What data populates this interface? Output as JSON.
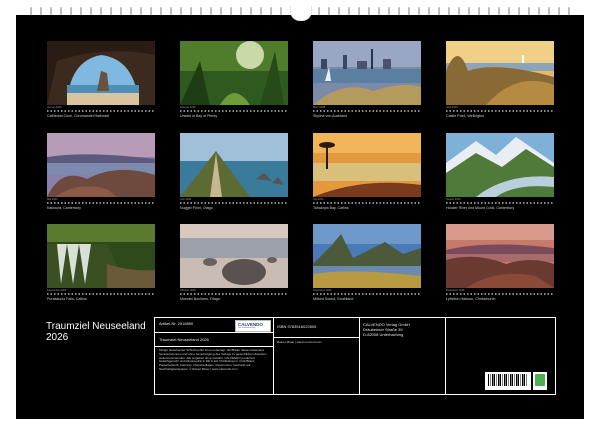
{
  "calendar": {
    "title_line1": "Traumziel Neuseeland",
    "title_line2": "2026",
    "months": [
      {
        "month": "Januar 2026",
        "caption": "Cathedral Cove, Coromandel Halbinsel"
      },
      {
        "month": "Februar 2026",
        "caption": "Urwald in Bay of Plenty"
      },
      {
        "month": "März 2026",
        "caption": "Skyline von Auckland"
      },
      {
        "month": "April 2026",
        "caption": "Castle Point, Wellington"
      },
      {
        "month": "Mai 2026",
        "caption": "Kaikoura, Canterbury"
      },
      {
        "month": "Juni 2026",
        "caption": "Nugget Point, Otago"
      },
      {
        "month": "Juli 2026",
        "caption": "Tahakopa Bay, Catlins"
      },
      {
        "month": "August 2026",
        "caption": "Hooker River und Mount Cook, Canterbury"
      },
      {
        "month": "September 2026",
        "caption": "Purakaunui Falls, Catlins"
      },
      {
        "month": "Oktober 2026",
        "caption": "Moeraki Boulders, Otago"
      },
      {
        "month": "November 2026",
        "caption": "Milford Sound, Southland"
      },
      {
        "month": "Dezember 2026",
        "caption": "Lyttelton Harbour, Christchurch"
      }
    ]
  },
  "info": {
    "article_no": "Artikel-Nr. 2016890",
    "logo_text": "CALVENDO",
    "logo_sub": "Der Kalenderverlag",
    "product_name": "Traumziel Neuseeland 2026",
    "legal_text": "Infolge bestehender Schutzrechte ist es untersagt, die Blätter dieses Kalenders herauszutrennen und ohne Genehmigung des Verlags zu gewerblichen Zwecken weiterzuverwenden. Alle Angaben ohne Gewähr. CALVENDO produziert bedarfsgerecht und klimaneutral in DE & EU. Publikationen: CO2-Bilanz, Papierherkunft, Fairness, Kleinstauflagen, Ressourcen. Gedruckt auf Nachhaltigkeitspapier. © Rainer Mirau / www.calvendo.com",
    "isbn": "ISBN 9783516022605",
    "photographer": "Rainer Mirau | silent-moment.com",
    "publisher_line1": "CALVENDO Verlag GmbH",
    "publisher_line2": "Dräubeimer Straße 39",
    "publisher_line3": "D-82008 Unterhaching"
  }
}
